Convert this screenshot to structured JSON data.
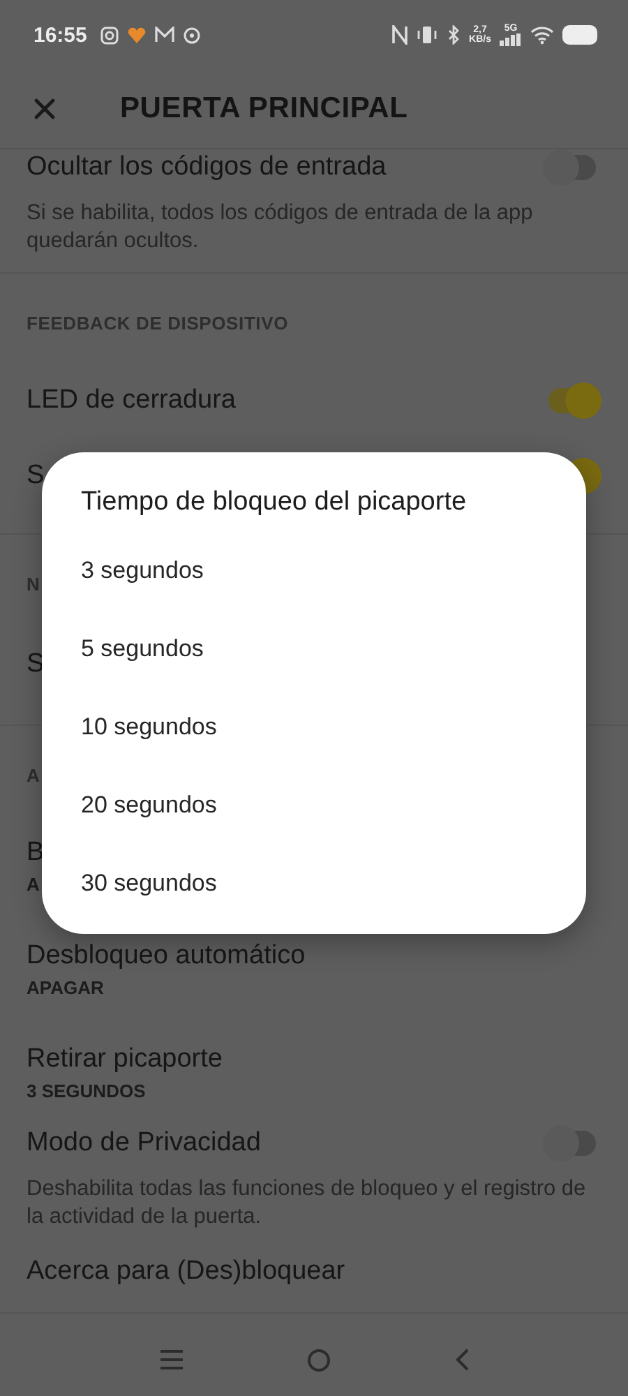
{
  "status_bar": {
    "time": "16:55",
    "net_speed": "2,7",
    "net_unit": "KB/s",
    "network": "5G"
  },
  "app_bar": {
    "title": "PUERTA PRINCIPAL"
  },
  "sections": [
    {
      "rows": [
        {
          "kind": "toggle",
          "title": "Ocultar los códigos de entrada",
          "description": "Si se habilita, todos los códigos de entrada de la app quedarán ocultos.",
          "on": false
        }
      ]
    },
    {
      "header": "FEEDBACK DE DISPOSITIVO",
      "rows": [
        {
          "kind": "toggle",
          "title": "LED de cerradura",
          "on": true
        },
        {
          "kind": "toggle",
          "title": "S",
          "on": true
        }
      ]
    },
    {
      "header": "N",
      "rows": [
        {
          "kind": "plain",
          "title": "S"
        }
      ]
    },
    {
      "header": "A",
      "rows": [
        {
          "kind": "value",
          "title": "B",
          "value": "A"
        },
        {
          "kind": "value",
          "title": "Desbloqueo automático",
          "value": "APAGAR"
        },
        {
          "kind": "value",
          "title": "Retirar picaporte",
          "value": "3 SEGUNDOS"
        },
        {
          "kind": "toggle",
          "title": "Modo de Privacidad",
          "description": "Deshabilita todas las funciones de bloqueo y el registro de la actividad de la puerta.",
          "on": false
        },
        {
          "kind": "plain",
          "title": "Acerca para (Des)bloquear"
        }
      ]
    }
  ],
  "dialog": {
    "title": "Tiempo de bloqueo del picaporte",
    "options": [
      {
        "label": "3 segundos"
      },
      {
        "label": "5 segundos"
      },
      {
        "label": "10 segundos"
      },
      {
        "label": "20 segundos"
      },
      {
        "label": "30 segundos"
      }
    ]
  }
}
